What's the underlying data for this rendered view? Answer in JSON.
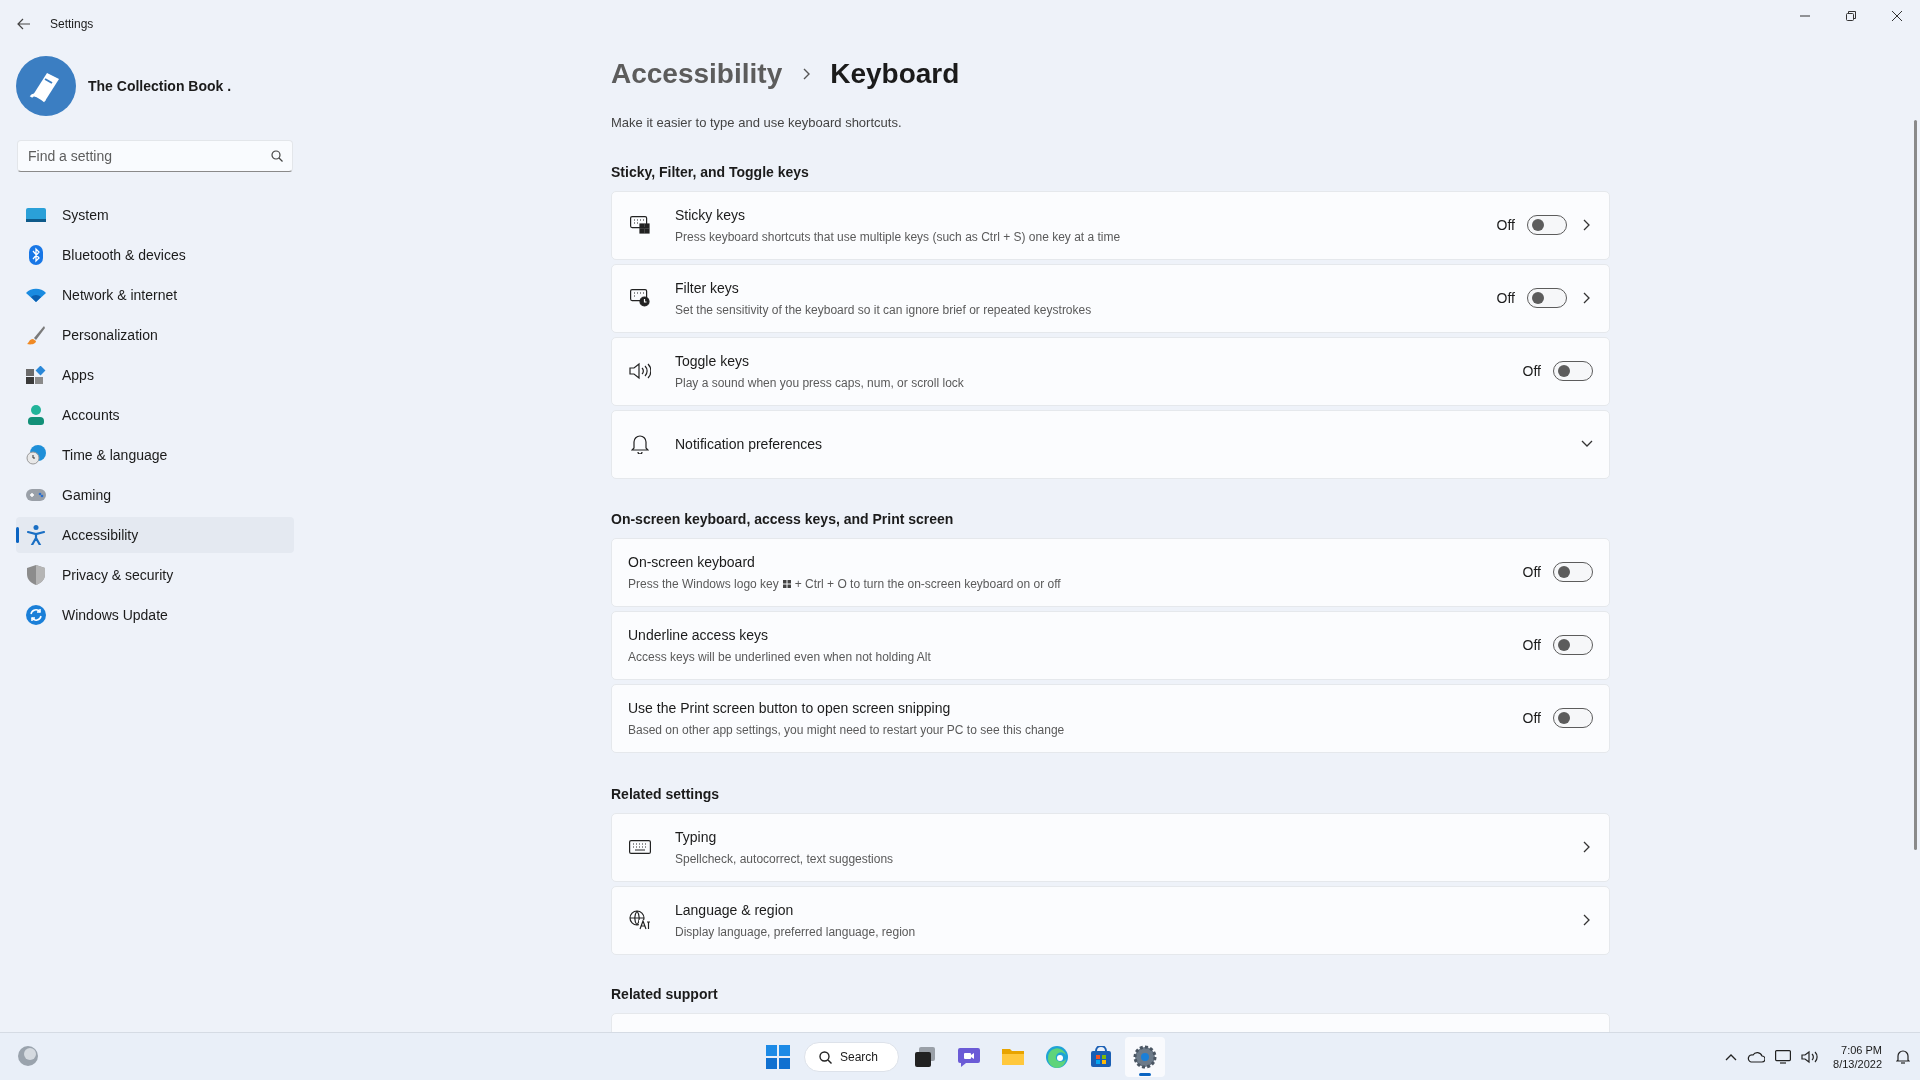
{
  "window": {
    "title": "Settings"
  },
  "profile": {
    "name": "The Collection Book ."
  },
  "search": {
    "placeholder": "Find a setting"
  },
  "nav": [
    {
      "label": "System",
      "selected": false
    },
    {
      "label": "Bluetooth & devices",
      "selected": false
    },
    {
      "label": "Network & internet",
      "selected": false
    },
    {
      "label": "Personalization",
      "selected": false
    },
    {
      "label": "Apps",
      "selected": false
    },
    {
      "label": "Accounts",
      "selected": false
    },
    {
      "label": "Time & language",
      "selected": false
    },
    {
      "label": "Gaming",
      "selected": false
    },
    {
      "label": "Accessibility",
      "selected": true
    },
    {
      "label": "Privacy & security",
      "selected": false
    },
    {
      "label": "Windows Update",
      "selected": false
    }
  ],
  "page": {
    "breadcrumb_parent": "Accessibility",
    "title": "Keyboard",
    "description": "Make it easier to type and use keyboard shortcuts."
  },
  "sections": [
    {
      "title": "Sticky, Filter, and Toggle keys",
      "cards": [
        {
          "kind": "toggle_link",
          "title": "Sticky keys",
          "description": "Press keyboard shortcuts that use multiple keys (such as Ctrl + S) one key at a time",
          "on": false,
          "state_label": "Off"
        },
        {
          "kind": "toggle_link",
          "title": "Filter keys",
          "description": "Set the sensitivity of the keyboard so it can ignore brief or repeated keystrokes",
          "on": false,
          "state_label": "Off"
        },
        {
          "kind": "toggle",
          "title": "Toggle keys",
          "description": "Play a sound when you press caps, num, or scroll lock",
          "on": false,
          "state_label": "Off"
        },
        {
          "kind": "expander",
          "title": "Notification preferences",
          "expanded": false
        }
      ]
    },
    {
      "title": "On-screen keyboard, access keys, and Print screen",
      "cards": [
        {
          "kind": "toggle",
          "title": "On-screen keyboard",
          "description": "Press the Windows logo key",
          "description_after": "+ Ctrl + O to turn the on-screen keyboard on or off",
          "on": false,
          "state_label": "Off"
        },
        {
          "kind": "toggle",
          "title": "Underline access keys",
          "description": "Access keys will be underlined even when not holding Alt",
          "on": false,
          "state_label": "Off"
        },
        {
          "kind": "toggle",
          "title": "Use the Print screen button to open screen snipping",
          "description": "Based on other app settings, you might need to restart your PC to see this change",
          "on": false,
          "state_label": "Off"
        }
      ]
    },
    {
      "title": "Related settings",
      "cards": [
        {
          "kind": "link",
          "title": "Typing",
          "description": "Spellcheck, autocorrect, text suggestions"
        },
        {
          "kind": "link",
          "title": "Language & region",
          "description": "Display language, preferred language, region"
        }
      ]
    },
    {
      "title": "Related support",
      "cards": [
        {
          "kind": "cut_off"
        }
      ]
    }
  ],
  "taskbar": {
    "search_label": "Search",
    "time": "7:06 PM",
    "date": "8/13/2022"
  }
}
